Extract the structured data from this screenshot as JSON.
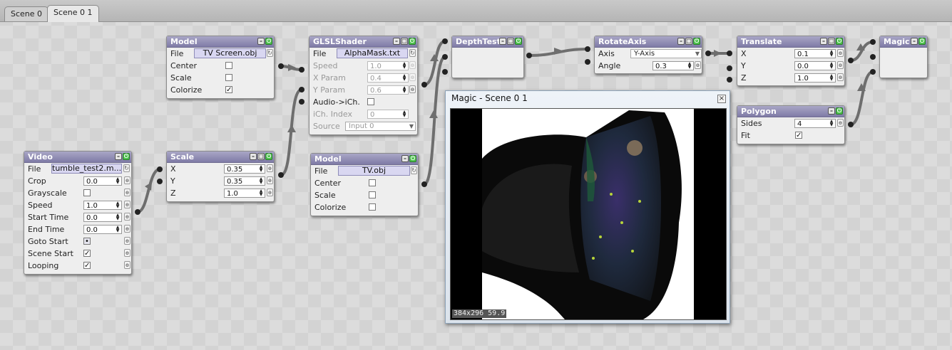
{
  "tabs": [
    "Scene 0",
    "Scene 0 1"
  ],
  "nodes": {
    "video": {
      "title": "Video",
      "file_label": "File",
      "file_value": "tumble_test2.m...",
      "crop_label": "Crop",
      "crop_value": "0.0",
      "grayscale_label": "Grayscale",
      "grayscale_checked": false,
      "speed_label": "Speed",
      "speed_value": "1.0",
      "start_time_label": "Start Time",
      "start_time_value": "0.0",
      "end_time_label": "End Time",
      "end_time_value": "0.0",
      "goto_start_label": "Goto Start",
      "scene_start_label": "Scene Start",
      "scene_start_checked": true,
      "looping_label": "Looping",
      "looping_checked": true
    },
    "scale": {
      "title": "Scale",
      "x_label": "X",
      "x_value": "0.35",
      "y_label": "Y",
      "y_value": "0.35",
      "z_label": "Z",
      "z_value": "1.0"
    },
    "model1": {
      "title": "Model",
      "file_label": "File",
      "file_value": "TV Screen.obj",
      "center_label": "Center",
      "center_checked": false,
      "scale_label": "Scale",
      "scale_checked": false,
      "colorize_label": "Colorize",
      "colorize_checked": true
    },
    "glsl": {
      "title": "GLSLShader",
      "file_label": "File",
      "file_value": "AlphaMask.txt",
      "speed_label": "Speed",
      "speed_value": "1.0",
      "xparam_label": "X Param",
      "xparam_value": "0.4",
      "yparam_label": "Y Param",
      "yparam_value": "0.6",
      "audio_label": "Audio->iCh.",
      "audio_checked": false,
      "ich_label": "iCh. Index",
      "ich_value": "0",
      "source_label": "Source",
      "source_value": "Input 0"
    },
    "model2": {
      "title": "Model",
      "file_label": "File",
      "file_value": "TV.obj",
      "center_label": "Center",
      "center_checked": false,
      "scale_label": "Scale",
      "scale_checked": false,
      "colorize_label": "Colorize",
      "colorize_checked": false
    },
    "depthtest": {
      "title": "DepthTest"
    },
    "rotateaxis": {
      "title": "RotateAxis",
      "axis_label": "Axis",
      "axis_value": "Y-Axis",
      "angle_label": "Angle",
      "angle_value": "0.3"
    },
    "translate": {
      "title": "Translate",
      "x_label": "X",
      "x_value": "0.1",
      "y_label": "Y",
      "y_value": "0.0",
      "z_label": "Z",
      "z_value": "1.0"
    },
    "magic": {
      "title": "Magic"
    },
    "polygon": {
      "title": "Polygon",
      "sides_label": "Sides",
      "sides_value": "4",
      "fit_label": "Fit",
      "fit_checked": true
    }
  },
  "preview": {
    "title": "Magic - Scene 0 1",
    "stats": "384x296 59.9"
  },
  "colors": {
    "node_header": "#8f8bb5",
    "enable_button": "#4cc24c",
    "wire": "#6e6e6e",
    "canvas_bg": "#dcdcdc"
  },
  "icons": {
    "minimize": "minimize-icon",
    "enable": "power-icon",
    "lock": "lock-icon",
    "link": "link-icon",
    "close": "close-icon",
    "dropdown": "chevron-down-icon"
  }
}
